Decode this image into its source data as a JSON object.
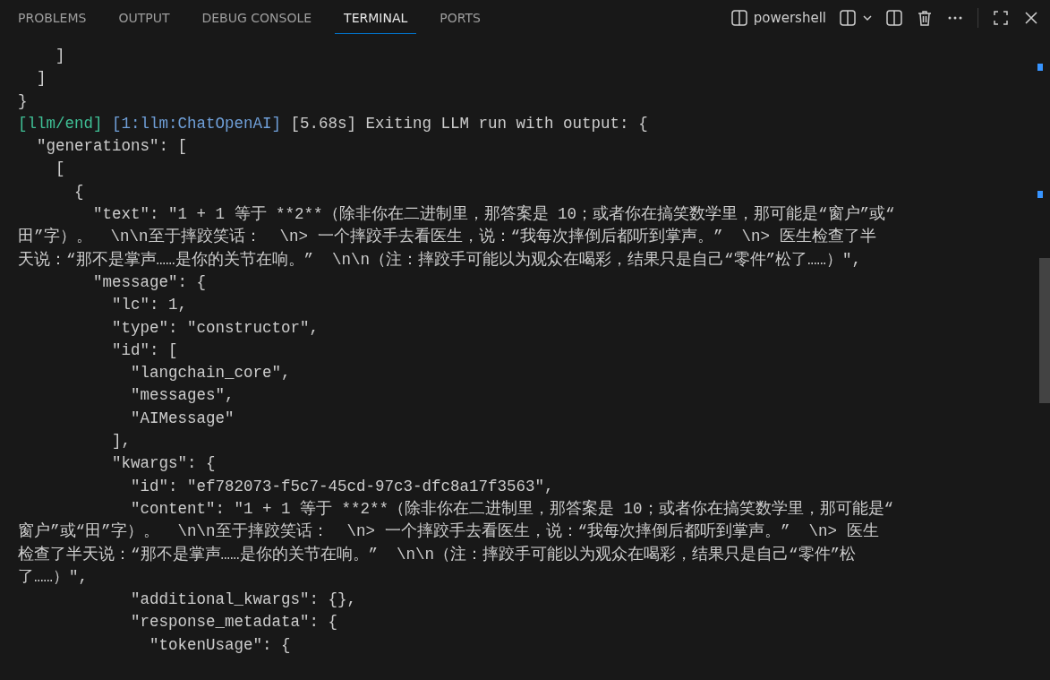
{
  "panel_tabs": [
    {
      "label": "PROBLEMS",
      "selected": false
    },
    {
      "label": "OUTPUT",
      "selected": false
    },
    {
      "label": "DEBUG CONSOLE",
      "selected": false
    },
    {
      "label": "TERMINAL",
      "selected": true
    },
    {
      "label": "PORTS",
      "selected": false
    }
  ],
  "terminal_name": "powershell",
  "terminal_lines": [
    {
      "segments": [
        {
          "text": "    ]"
        }
      ]
    },
    {
      "segments": [
        {
          "text": "  ]"
        }
      ]
    },
    {
      "segments": [
        {
          "text": "}"
        }
      ]
    },
    {
      "segments": [
        {
          "text": "[llm/end]",
          "color": "#3fbf95"
        },
        {
          "text": " [1:llm:ChatOpenAI]",
          "color": "#6f9fd8"
        },
        {
          "text": " [5.68s] Exiting LLM run with output: {"
        }
      ]
    },
    {
      "segments": [
        {
          "text": "  \"generations\": ["
        }
      ]
    },
    {
      "segments": [
        {
          "text": "    ["
        }
      ]
    },
    {
      "segments": [
        {
          "text": "      {"
        }
      ]
    },
    {
      "segments": [
        {
          "text": "        \"text\": \"1 + 1 等于 **2**（除非你在二进制里，那答案是 10；或者你在搞笑数学里，那可能是“窗户”或“"
        }
      ]
    },
    {
      "segments": [
        {
          "text": "田”字）。  \\n\\n至于摔跤笑话：  \\n> 一个摔跤手去看医生，说：“我每次摔倒后都听到掌声。”  \\n> 医生检查了半"
        }
      ]
    },
    {
      "segments": [
        {
          "text": "天说：“那不是掌声……是你的关节在响。”  \\n\\n（注：摔跤手可能以为观众在喝彩，结果只是自己“零件”松了……）\","
        }
      ]
    },
    {
      "segments": [
        {
          "text": "        \"message\": {"
        }
      ]
    },
    {
      "segments": [
        {
          "text": "          \"lc\": 1,"
        }
      ]
    },
    {
      "segments": [
        {
          "text": "          \"type\": \"constructor\","
        }
      ]
    },
    {
      "segments": [
        {
          "text": "          \"id\": ["
        }
      ]
    },
    {
      "segments": [
        {
          "text": "            \"langchain_core\","
        }
      ]
    },
    {
      "segments": [
        {
          "text": "            \"messages\","
        }
      ]
    },
    {
      "segments": [
        {
          "text": "            \"AIMessage\""
        }
      ]
    },
    {
      "segments": [
        {
          "text": "          ],"
        }
      ]
    },
    {
      "segments": [
        {
          "text": "          \"kwargs\": {"
        }
      ]
    },
    {
      "segments": [
        {
          "text": "            \"id\": \"ef782073-f5c7-45cd-97c3-dfc8a17f3563\","
        }
      ]
    },
    {
      "segments": [
        {
          "text": "            \"content\": \"1 + 1 等于 **2**（除非你在二进制里，那答案是 10；或者你在搞笑数学里，那可能是“"
        }
      ]
    },
    {
      "segments": [
        {
          "text": "窗户”或“田”字）。  \\n\\n至于摔跤笑话：  \\n> 一个摔跤手去看医生，说：“我每次摔倒后都听到掌声。”  \\n> 医生"
        }
      ]
    },
    {
      "segments": [
        {
          "text": "检查了半天说：“那不是掌声……是你的关节在响。”  \\n\\n（注：摔跤手可能以为观众在喝彩，结果只是自己“零件”松"
        }
      ]
    },
    {
      "segments": [
        {
          "text": "了……）\","
        }
      ]
    },
    {
      "segments": [
        {
          "text": "            \"additional_kwargs\": {},"
        }
      ]
    },
    {
      "segments": [
        {
          "text": "            \"response_metadata\": {"
        }
      ]
    },
    {
      "segments": [
        {
          "text": "              \"tokenUsage\": {"
        }
      ]
    }
  ]
}
